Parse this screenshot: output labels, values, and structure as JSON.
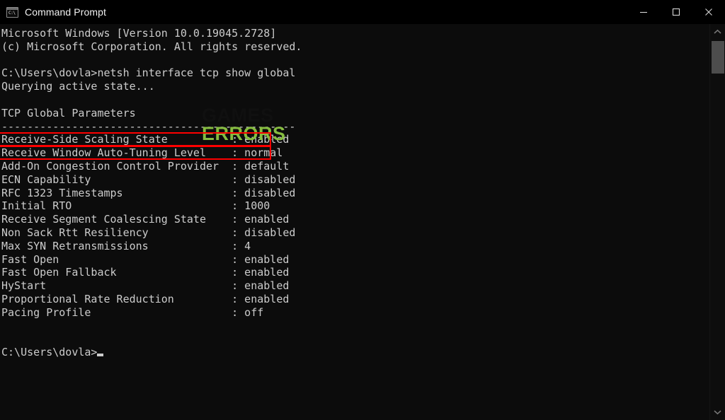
{
  "window": {
    "title": "Command Prompt",
    "icon": "command-prompt-icon",
    "icon_glyph": "C:\\",
    "background": "#0c0c0c",
    "titlebar_background": "#000000",
    "text_color": "#cccccc"
  },
  "titlebar_buttons": {
    "minimize": "minimize-icon",
    "maximize": "maximize-icon",
    "close": "close-icon"
  },
  "terminal": {
    "lines": [
      "Microsoft Windows [Version 10.0.19045.2728]",
      "(c) Microsoft Corporation. All rights reserved.",
      "",
      "C:\\Users\\dovla>netsh interface tcp show global",
      "Querying active state...",
      "",
      "TCP Global Parameters",
      "----------------------------------------------",
      "Receive-Side Scaling State          : enabled",
      "Receive Window Auto-Tuning Level    : normal",
      "Add-On Congestion Control Provider  : default",
      "ECN Capability                      : disabled",
      "RFC 1323 Timestamps                 : disabled",
      "Initial RTO                         : 1000",
      "Receive Segment Coalescing State    : enabled",
      "Non Sack Rtt Resiliency             : disabled",
      "Max SYN Retransmissions             : 4",
      "Fast Open                           : enabled",
      "Fast Open Fallback                  : enabled",
      "HyStart                             : enabled",
      "Proportional Rate Reduction         : enabled",
      "Pacing Profile                      : off",
      "",
      "",
      "C:\\Users\\dovla>"
    ],
    "prompt": "C:\\Users\\dovla>",
    "command": "netsh interface tcp show global",
    "parameters": [
      {
        "name": "Receive-Side Scaling State",
        "value": "enabled",
        "highlighted": true
      },
      {
        "name": "Receive Window Auto-Tuning Level",
        "value": "normal",
        "highlighted": true
      },
      {
        "name": "Add-On Congestion Control Provider",
        "value": "default",
        "highlighted": false
      },
      {
        "name": "ECN Capability",
        "value": "disabled",
        "highlighted": false
      },
      {
        "name": "RFC 1323 Timestamps",
        "value": "disabled",
        "highlighted": false
      },
      {
        "name": "Initial RTO",
        "value": "1000",
        "highlighted": false
      },
      {
        "name": "Receive Segment Coalescing State",
        "value": "enabled",
        "highlighted": false
      },
      {
        "name": "Non Sack Rtt Resiliency",
        "value": "disabled",
        "highlighted": false
      },
      {
        "name": "Max SYN Retransmissions",
        "value": "4",
        "highlighted": false
      },
      {
        "name": "Fast Open",
        "value": "enabled",
        "highlighted": false
      },
      {
        "name": "Fast Open Fallback",
        "value": "enabled",
        "highlighted": false
      },
      {
        "name": "HyStart",
        "value": "enabled",
        "highlighted": false
      },
      {
        "name": "Proportional Rate Reduction",
        "value": "enabled",
        "highlighted": false
      },
      {
        "name": "Pacing Profile",
        "value": "off",
        "highlighted": false
      }
    ]
  },
  "annotations": {
    "highlight_color": "#fe0000",
    "boxes": [
      {
        "label": "Receive-Side Scaling State : enabled"
      },
      {
        "label": "Receive Window Auto-Tuning Level : normal"
      }
    ]
  },
  "watermark": {
    "line1": "GAMES",
    "line2": "ERRORS",
    "line1_color": "#101010",
    "line2_color": "#86bc40"
  },
  "scrollbar": {
    "up": "chevron-up-icon",
    "down": "chevron-down-icon"
  }
}
